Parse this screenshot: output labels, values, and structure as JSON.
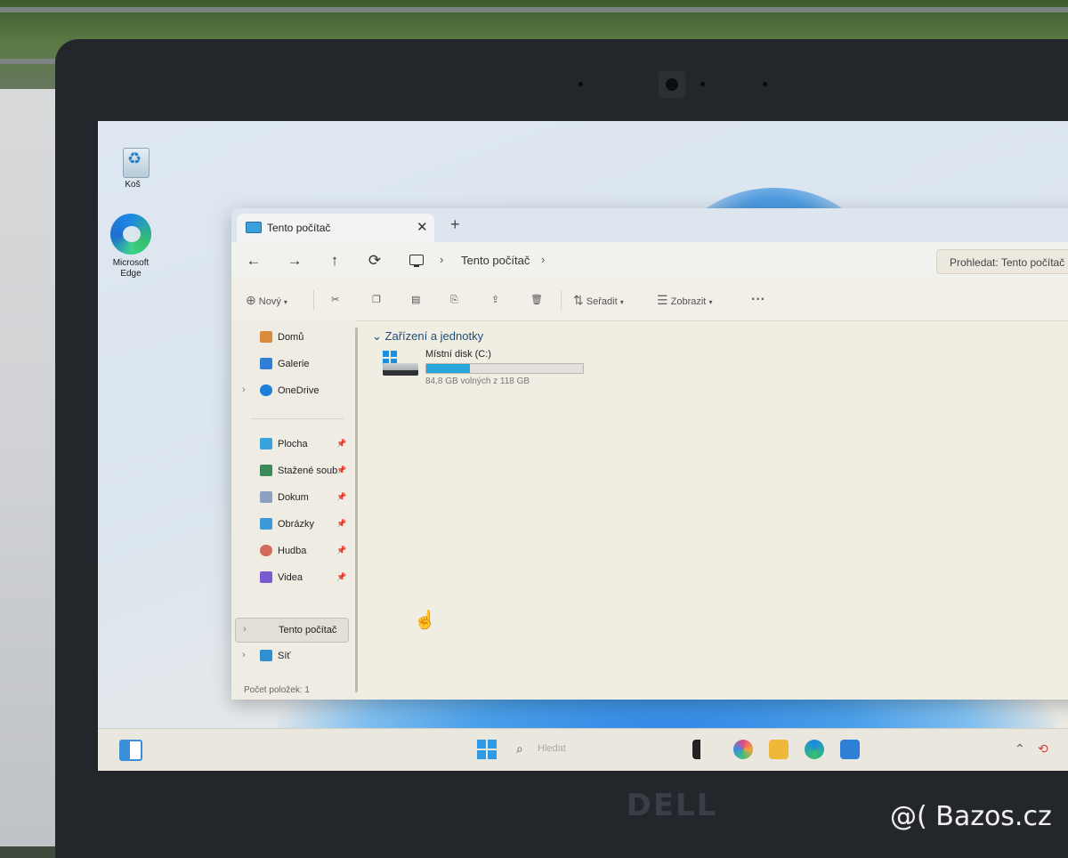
{
  "desktop": {
    "icons": [
      {
        "label": "Koš",
        "icon": "recycle-bin-icon"
      },
      {
        "label": "Microsoft Edge",
        "icon": "edge-icon"
      }
    ]
  },
  "explorer": {
    "tab_title": "Tento počítač",
    "tab_close": "✕",
    "new_tab": "+",
    "nav": {
      "back": "←",
      "forward": "→",
      "up": "↑",
      "refresh": "⟳"
    },
    "address": {
      "crumb": "Tento počítač",
      "sep": "›"
    },
    "search_placeholder": "Prohledat: Tento počítač",
    "toolbar": {
      "new_label": "Nový",
      "sort_label": "Seřadit",
      "view_label": "Zobrazit",
      "more": "···"
    },
    "sidebar": {
      "top": [
        {
          "label": "Domů",
          "icon": "home-icon",
          "color": "#d98a3a"
        },
        {
          "label": "Galerie",
          "icon": "gallery-icon",
          "color": "#2f7fd6"
        },
        {
          "label": "OneDrive",
          "icon": "onedrive-icon",
          "color": "#1e7fd8"
        }
      ],
      "pinned": [
        {
          "label": "Plocha",
          "icon": "desktop-folder-icon",
          "color": "#36a3dd"
        },
        {
          "label": "Stažené soub",
          "icon": "download-icon",
          "color": "#3a8a5a"
        },
        {
          "label": "Dokum",
          "icon": "documents-icon",
          "color": "#8aa2c0"
        },
        {
          "label": "Obrázky",
          "icon": "pictures-icon",
          "color": "#3b9ad8"
        },
        {
          "label": "Hudba",
          "icon": "music-icon",
          "color": "#d46a5a"
        },
        {
          "label": "Videa",
          "icon": "videos-icon",
          "color": "#7a5ad0"
        }
      ],
      "bottom": [
        {
          "label": "Tento počítač",
          "icon": "this-pc-icon",
          "color": "#3ab0d8"
        },
        {
          "label": "Síť",
          "icon": "network-icon",
          "color": "#2f8fd0"
        }
      ]
    },
    "group_header": "Zařízení a jednotky",
    "drive": {
      "name": "Místní disk (C:)",
      "free_text": "84,8 GB volných z 118 GB",
      "used_fraction": 0.28
    },
    "status": "Počet položek: 1"
  },
  "taskbar": {
    "search_placeholder": "Hledat"
  },
  "hardware": {
    "brand": "DELL"
  },
  "watermark": "@( Bazos.cz"
}
